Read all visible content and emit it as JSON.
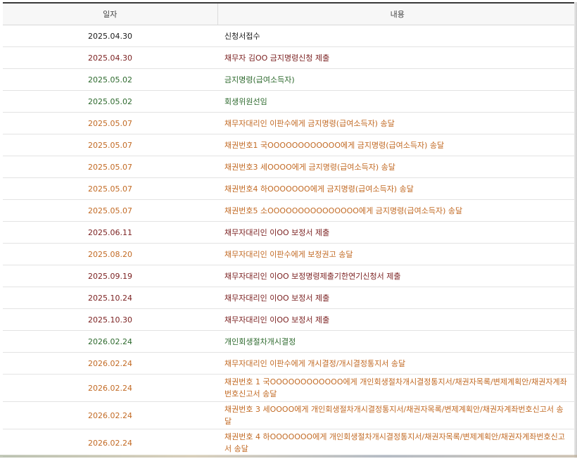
{
  "table": {
    "headers": {
      "date": "일자",
      "content": "내용"
    },
    "colors": {
      "black": "#1a1a1a",
      "red": "#7a1f1f",
      "green": "#2e6a2e",
      "orange": "#c26a24"
    },
    "rows": [
      {
        "date": "2025.04.30",
        "content": "신청서접수",
        "color": "black",
        "tall": false
      },
      {
        "date": "2025.04.30",
        "content": "채무자 김OO 금지명령신청 제출",
        "color": "red",
        "tall": false
      },
      {
        "date": "2025.05.02",
        "content": "금지명령(급여소득자)",
        "color": "green",
        "tall": false
      },
      {
        "date": "2025.05.02",
        "content": "회생위원선임",
        "color": "green",
        "tall": false
      },
      {
        "date": "2025.05.07",
        "content": "채무자대리인 이판수에게 금지명령(급여소득자) 송달",
        "color": "orange",
        "tall": false
      },
      {
        "date": "2025.05.07",
        "content": "채권번호1 국OOOOOOOOOOOO에게 금지명령(급여소득자) 송달",
        "color": "orange",
        "tall": false
      },
      {
        "date": "2025.05.07",
        "content": "채권번호3 세OOOO에게 금지명령(급여소득자) 송달",
        "color": "orange",
        "tall": false
      },
      {
        "date": "2025.05.07",
        "content": "채권번호4 하OOOOOOO에게 금지명령(급여소득자) 송달",
        "color": "orange",
        "tall": false
      },
      {
        "date": "2025.05.07",
        "content": "채권번호5 소OOOOOOOOOOOOOOO에게 금지명령(급여소득자) 송달",
        "color": "orange",
        "tall": false
      },
      {
        "date": "2025.06.11",
        "content": "채무자대리인 이OO 보정서 제출",
        "color": "red",
        "tall": false
      },
      {
        "date": "2025.08.20",
        "content": "채무자대리인 이판수에게 보정권고 송달",
        "color": "orange",
        "tall": false
      },
      {
        "date": "2025.09.19",
        "content": "채무자대리인 이OO 보정명령제출기한연기신청서 제출",
        "color": "red",
        "tall": false
      },
      {
        "date": "2025.10.24",
        "content": "채무자대리인 이OO 보정서 제출",
        "color": "red",
        "tall": false
      },
      {
        "date": "2025.10.30",
        "content": "채무자대리인 이OO 보정서 제출",
        "color": "red",
        "tall": false
      },
      {
        "date": "2026.02.24",
        "content": "개인회생절차개시결정",
        "color": "green",
        "tall": false
      },
      {
        "date": "2026.02.24",
        "content": "채무자대리인 이판수에게 개시결정/개시결정통지서 송달",
        "color": "orange",
        "tall": false
      },
      {
        "date": "2026.02.24",
        "content": "채권번호 1 국OOOOOOOOOOOO에게 개인회생절차개시결정통지서/채권자목록/변제계획안/채권자계좌번호신고서 송달",
        "color": "orange",
        "tall": true
      },
      {
        "date": "2026.02.24",
        "content": "채권번호 3 세OOOO에게 개인회생절차개시결정통지서/채권자목록/변제계획안/채권자계좌번호신고서 송달",
        "color": "orange",
        "tall": true
      },
      {
        "date": "2026.02.24",
        "content": "채권번호 4 하OOOOOOO에게 개인회생절차개시결정통지서/채권자목록/변제계획안/채권자계좌번호신고서 송달",
        "color": "orange",
        "tall": true
      }
    ]
  }
}
